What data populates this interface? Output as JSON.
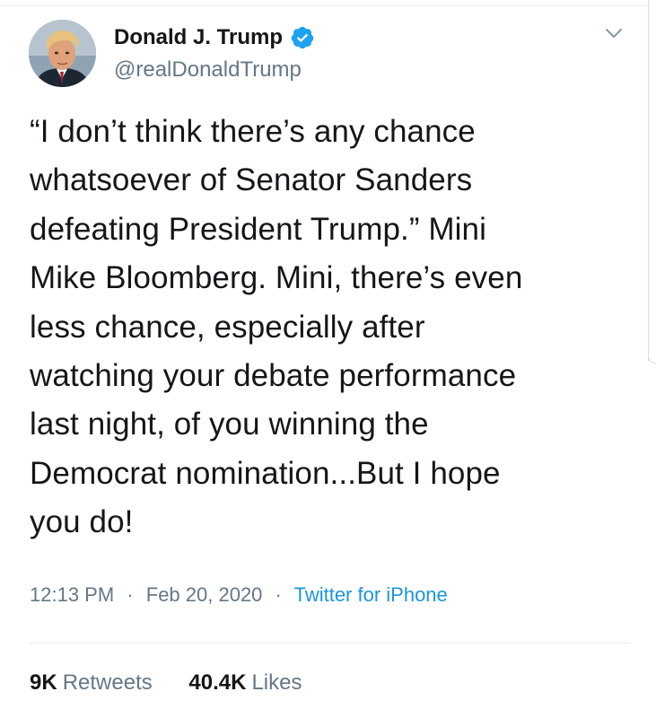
{
  "tweet": {
    "author": {
      "display_name": "Donald J. Trump",
      "handle": "@realDonaldTrump",
      "verified": true
    },
    "text": "“I don’t think there’s any chance\nwhatsoever of Senator Sanders\ndefeating President Trump.” Mini\nMike Bloomberg. Mini, there’s even\nless chance, especially after\nwatching your debate performance\nlast night, of you winning the\nDemocrat nomination...But I hope\nyou do!",
    "time": "12:13 PM",
    "date": "Feb 20, 2020",
    "separator": "·",
    "source": "Twitter for iPhone",
    "stats": {
      "retweets_count": "9K",
      "retweets_label": "Retweets",
      "likes_count": "40.4K",
      "likes_label": "Likes"
    }
  },
  "icons": {
    "verified": "verified-badge-icon",
    "menu": "chevron-down-icon"
  },
  "colors": {
    "text_primary": "#14171a",
    "text_secondary": "#657786",
    "link": "#1b95e0",
    "verified": "#1da1f2",
    "divider": "#e6ecf0"
  }
}
